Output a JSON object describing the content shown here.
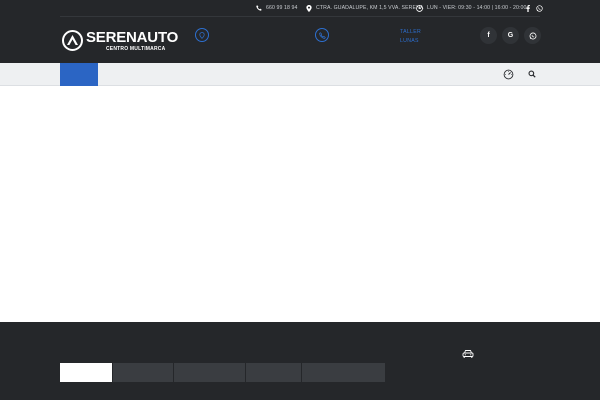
{
  "topbar": {
    "phone": "660 99 18 94",
    "address": "CTRA. GUADALUPE, KM 1,5 VVA. SERENA",
    "hours": "LUN - VIER: 09:30 - 14:00 | 16:00 - 20:00",
    "social": [
      "facebook-icon",
      "whatsapp-icon"
    ]
  },
  "brand": {
    "name": "SERENAUTO",
    "tagline": "CENTRO MULTIMARCA"
  },
  "services": {
    "items": [
      "TALLER",
      "LUNAS"
    ]
  },
  "header_social": [
    {
      "icon": "facebook-icon",
      "glyph": "f"
    },
    {
      "icon": "google-icon",
      "glyph": "G"
    },
    {
      "icon": "whatsapp-icon",
      "glyph": ""
    }
  ],
  "colors": {
    "accent": "#2b65c4",
    "header_bg": "#25272a",
    "nav_bg": "#eef0f2"
  },
  "footer": {
    "tabs": [
      "",
      "",
      "",
      "",
      ""
    ]
  }
}
